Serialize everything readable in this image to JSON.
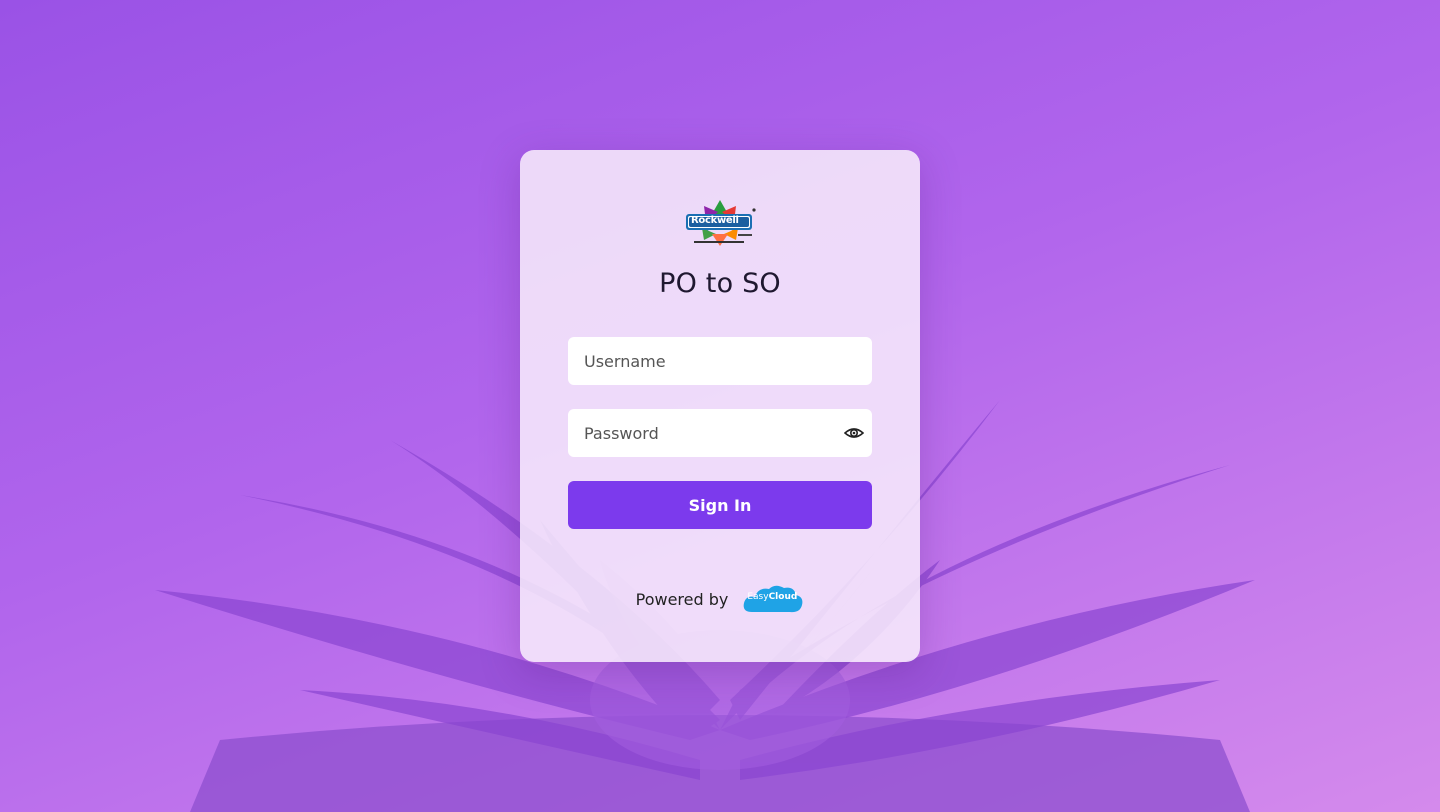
{
  "app": {
    "title": "PO to SO"
  },
  "brand": {
    "logo_text": "Rockwell",
    "logo_icon": "rockwell-logo",
    "logo_tagline": "The Refrigeration Company",
    "logo_since": "Since 1986"
  },
  "form": {
    "username_placeholder": "Username",
    "password_placeholder": "Password",
    "password_toggle_icon": "eye-icon",
    "signin_label": "Sign In"
  },
  "footer": {
    "powered_by": "Powered by",
    "partner_logo_icon": "easycloud-logo",
    "partner_name_prefix": "Easy",
    "partner_name_suffix": "Cloud"
  },
  "colors": {
    "accent": "#7c3aed",
    "background_start": "#9a52e6",
    "background_end": "#d48aec",
    "partner_blue": "#1fa3e6"
  }
}
